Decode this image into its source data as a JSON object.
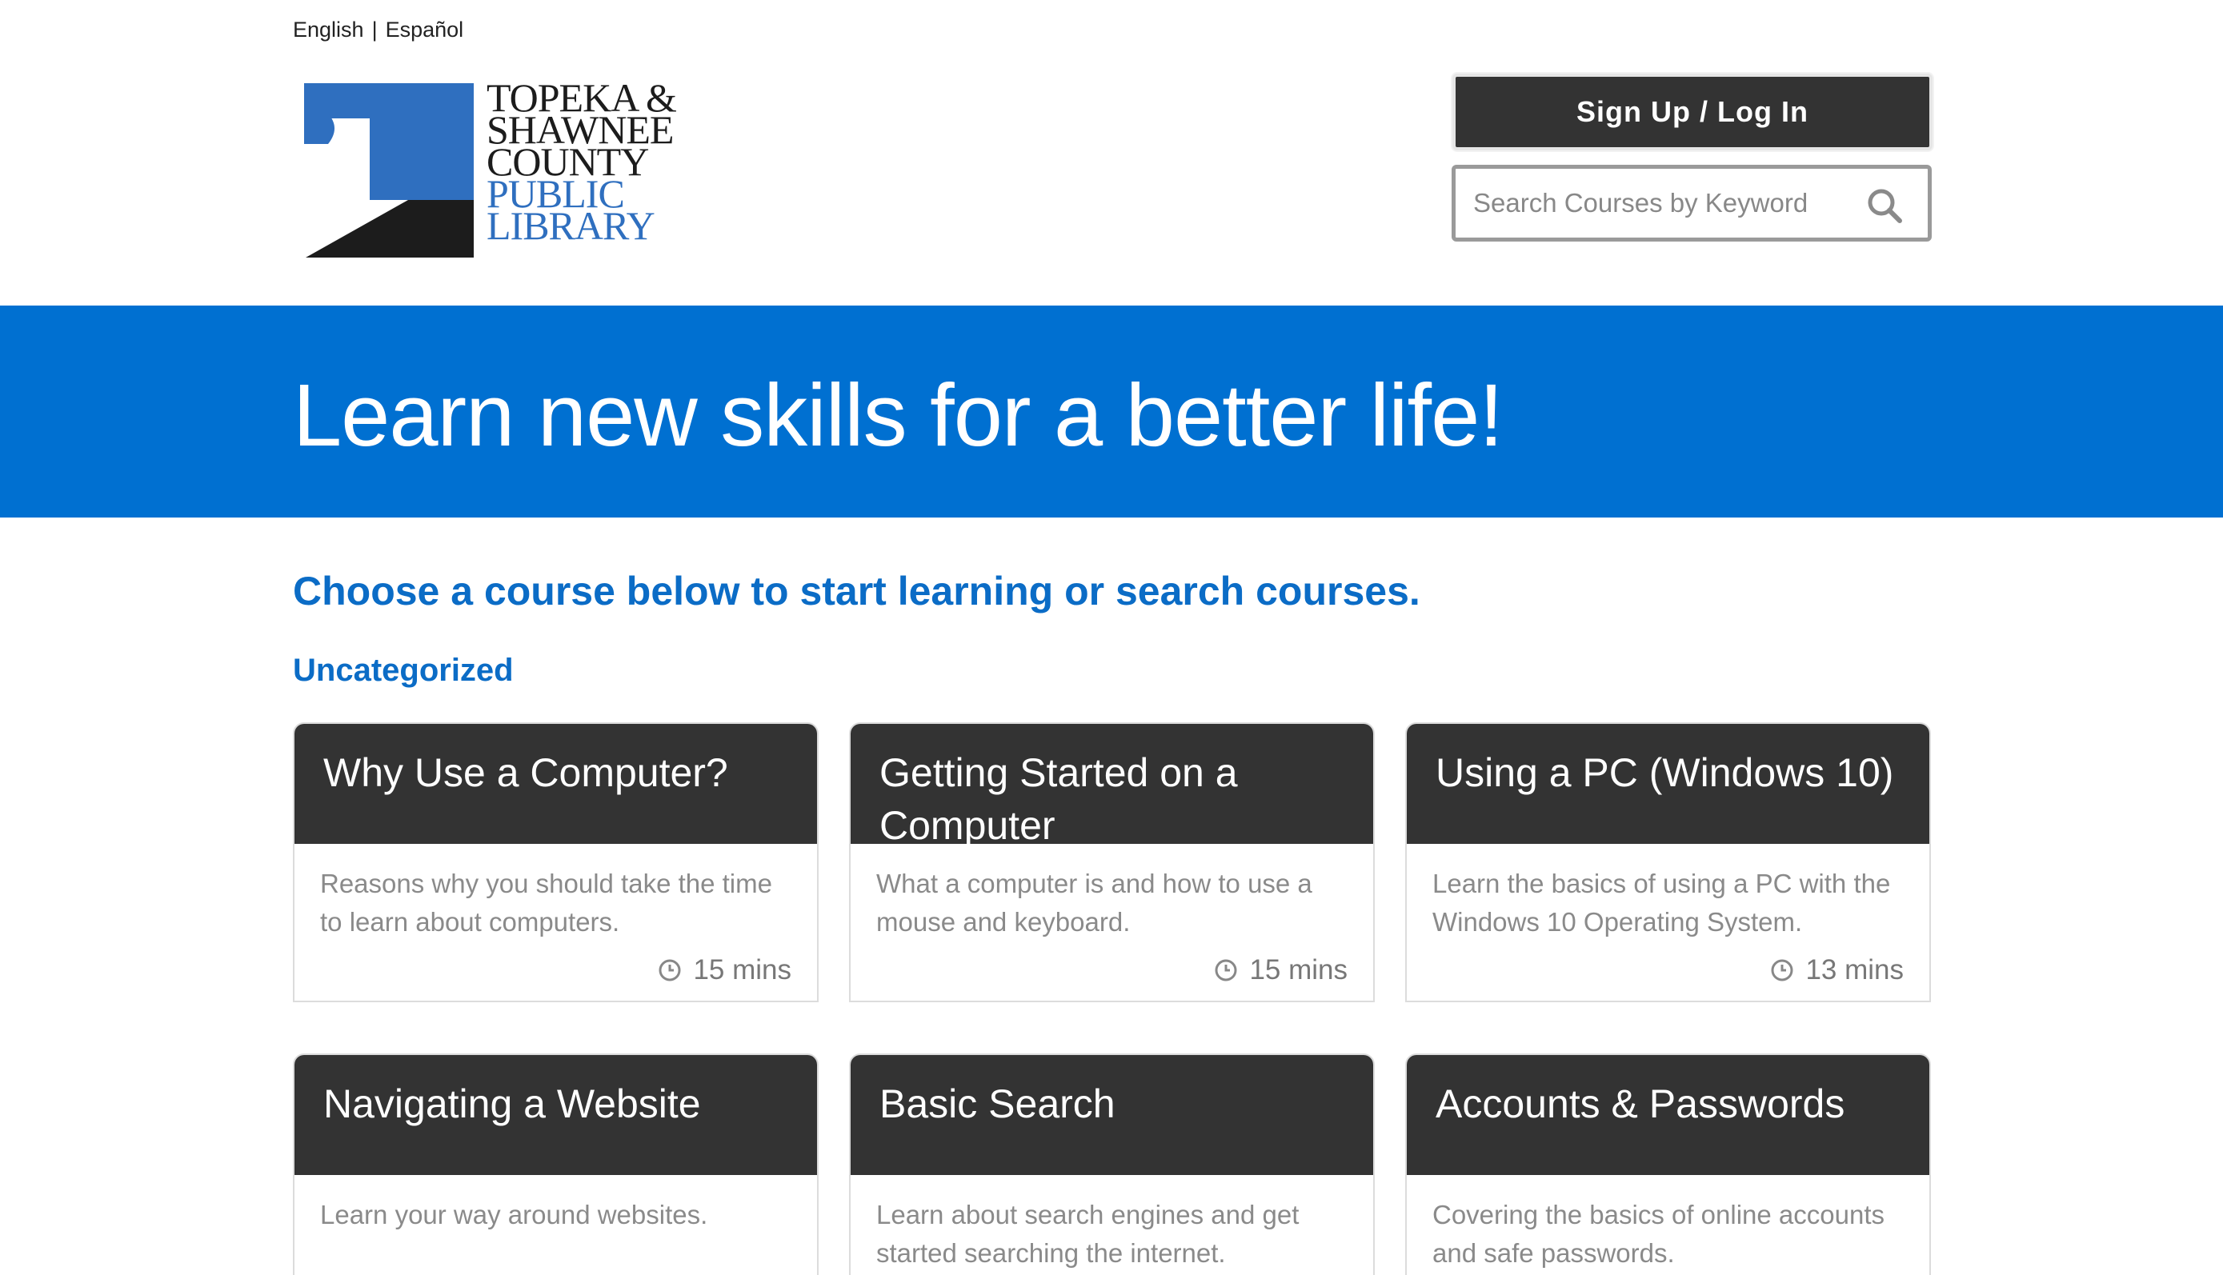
{
  "lang": {
    "english": "English",
    "separator": "|",
    "spanish": "Español"
  },
  "logo": {
    "line1": "TOPEKA &",
    "line2": "SHAWNEE",
    "line3": "COUNTY",
    "line4": "PUBLIC",
    "line5": "LIBRARY"
  },
  "header": {
    "login_label": "Sign Up / Log In",
    "search_placeholder": "Search Courses by Keyword"
  },
  "hero": {
    "title": "Learn new skills for a better life!"
  },
  "main": {
    "intro": "Choose a course below to start learning or search courses.",
    "category": "Uncategorized"
  },
  "courses": [
    {
      "title": "Why Use a Computer?",
      "description": "Reasons why you should take the time to learn about computers.",
      "duration": "15 mins"
    },
    {
      "title": "Getting Started on a Computer",
      "description": "What a computer is and how to use a mouse and keyboard.",
      "duration": "15 mins"
    },
    {
      "title": "Using a PC (Windows 10)",
      "description": "Learn the basics of using a PC with the Windows 10 Operating System.",
      "duration": "13 mins"
    },
    {
      "title": "Navigating a Website",
      "description": "Learn your way around websites."
    },
    {
      "title": "Basic Search",
      "description": "Learn about search engines and get started searching the internet."
    },
    {
      "title": "Accounts & Passwords",
      "description": "Covering the basics of online accounts and safe passwords."
    }
  ],
  "colors": {
    "brand_blue": "#0070d1",
    "heading_blue": "#0b6cc6",
    "dark": "#333333",
    "logo_blue": "#2f6fbf"
  }
}
